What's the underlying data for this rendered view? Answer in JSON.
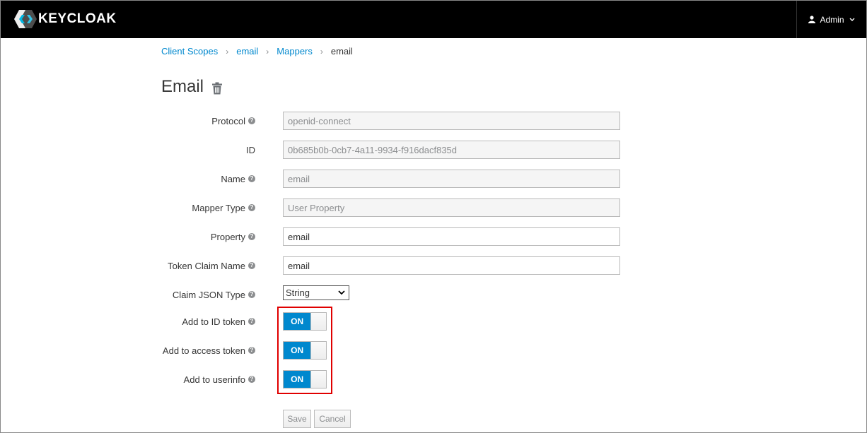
{
  "header": {
    "logo_text": "KEYCLOAK",
    "user_label": "Admin"
  },
  "breadcrumb": {
    "items": [
      "Client Scopes",
      "email",
      "Mappers"
    ],
    "current": "email"
  },
  "page": {
    "title": "Email"
  },
  "form": {
    "protocol": {
      "label": "Protocol",
      "value": "openid-connect"
    },
    "id": {
      "label": "ID",
      "value": "0b685b0b-0cb7-4a11-9934-f916dacf835d"
    },
    "name": {
      "label": "Name",
      "value": "email"
    },
    "mapper_type": {
      "label": "Mapper Type",
      "value": "User Property"
    },
    "property": {
      "label": "Property",
      "value": "email"
    },
    "token_claim_name": {
      "label": "Token Claim Name",
      "value": "email"
    },
    "claim_json_type": {
      "label": "Claim JSON Type",
      "value": "String"
    },
    "add_to_id_token": {
      "label": "Add to ID token",
      "state": "ON"
    },
    "add_to_access_token": {
      "label": "Add to access token",
      "state": "ON"
    },
    "add_to_userinfo": {
      "label": "Add to userinfo",
      "state": "ON"
    }
  },
  "buttons": {
    "save": "Save",
    "cancel": "Cancel"
  },
  "colors": {
    "accent": "#0088ce",
    "header_bg": "#000000",
    "highlight": "#e00000"
  }
}
